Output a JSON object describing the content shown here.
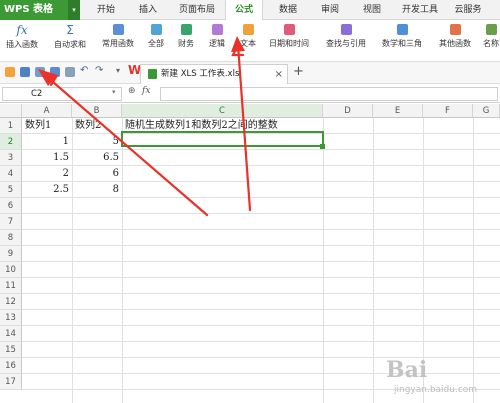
{
  "app": {
    "logo": "WPS 表格"
  },
  "menu_tabs": [
    {
      "label": "开始"
    },
    {
      "label": "插入"
    },
    {
      "label": "页面布局"
    },
    {
      "label": "公式"
    },
    {
      "label": "数据"
    },
    {
      "label": "审阅"
    },
    {
      "label": "视图"
    },
    {
      "label": "开发工具"
    },
    {
      "label": "云服务"
    }
  ],
  "active_tab": "公式",
  "ribbon": [
    {
      "label": "插入函数",
      "icon": "fx-icon"
    },
    {
      "label": "自动求和",
      "icon": "sigma-icon"
    },
    {
      "label": "常用函数",
      "icon": "function-icon"
    },
    {
      "label": "全部",
      "icon": "all-functions-icon"
    },
    {
      "label": "财务",
      "icon": "finance-icon"
    },
    {
      "label": "逻辑",
      "icon": "logic-icon"
    },
    {
      "label": "文本",
      "icon": "text-icon"
    },
    {
      "label": "日期和时间",
      "icon": "date-time-icon"
    },
    {
      "label": "查找与引用",
      "icon": "lookup-icon"
    },
    {
      "label": "数学和三角",
      "icon": "math-icon"
    },
    {
      "label": "其他函数",
      "icon": "more-functions-icon"
    },
    {
      "label": "名称",
      "icon": "name-icon"
    }
  ],
  "fx_symbol": "fx",
  "sigma_symbol": "Σ",
  "document_tab": {
    "title": "新建 XLS 工作表.xls",
    "close": "×",
    "new": "+"
  },
  "formula_bar": {
    "cell_ref": "C2",
    "fx_label": "fx",
    "content": ""
  },
  "columns": [
    "A",
    "B",
    "C",
    "D",
    "E",
    "F",
    "G"
  ],
  "selected_column": "C",
  "rows": [
    "1",
    "2",
    "3",
    "4",
    "5",
    "6",
    "7",
    "8",
    "9",
    "10",
    "11",
    "12",
    "13",
    "14",
    "15",
    "16",
    "17"
  ],
  "selected_row": "2",
  "cells": {
    "A1": "数列1",
    "B1": "数列2",
    "C1": "随机生成数列1和数列2之间的整数",
    "A2": "1",
    "B2": "5",
    "A3": "1.5",
    "B3": "6.5",
    "A4": "2",
    "B4": "6",
    "A5": "2.5",
    "B5": "8"
  },
  "watermark": {
    "logo": "Bai",
    "url": "jingyan.baidu.com"
  },
  "colors": {
    "brand": "#3c9a35",
    "arrow": "#e8322a",
    "selection": "#3c9a35"
  }
}
